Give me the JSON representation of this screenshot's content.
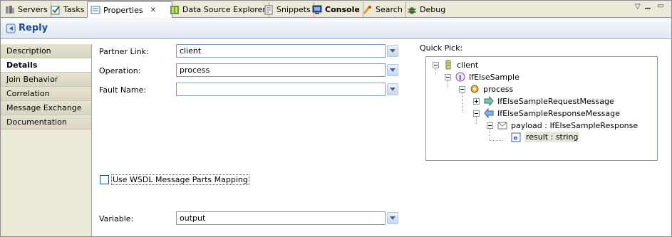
{
  "tabs": [
    {
      "label": "Servers",
      "icon": "servers-icon"
    },
    {
      "label": "Tasks",
      "icon": "tasks-icon"
    },
    {
      "label": "Properties",
      "icon": "properties-icon",
      "active": true
    },
    {
      "label": "Data Source Explorer",
      "icon": "data-source-icon"
    },
    {
      "label": "Snippets",
      "icon": "snippets-icon"
    },
    {
      "label": "Console",
      "icon": "console-icon"
    },
    {
      "label": "Search",
      "icon": "search-icon"
    },
    {
      "label": "Debug",
      "icon": "debug-icon"
    }
  ],
  "header": {
    "title": "Reply",
    "icon": "reply-icon"
  },
  "nav": [
    "Description",
    "Details",
    "Join Behavior",
    "Correlation",
    "Message Exchange",
    "Documentation"
  ],
  "nav_active": "Details",
  "form": {
    "partner_link_label": "Partner Link:",
    "partner_link_value": "client",
    "operation_label": "Operation:",
    "operation_value": "process",
    "fault_name_label": "Fault Name:",
    "fault_name_value": "",
    "wsdl_mapping_label": "Use WSDL Message Parts Mapping",
    "wsdl_mapping_checked": false,
    "variable_label": "Variable:",
    "variable_value": "output"
  },
  "quick_pick": {
    "label": "Quick Pick:",
    "tree": [
      {
        "text": "client",
        "icon": "partner-link-icon"
      },
      {
        "text": "IfElseSample",
        "icon": "interface-icon"
      },
      {
        "text": "process",
        "icon": "operation-icon"
      },
      {
        "text": "IfElseSampleRequestMessage",
        "icon": "input-message-icon"
      },
      {
        "text": "IfElseSampleResponseMessage",
        "icon": "output-message-icon"
      },
      {
        "text": "payload : IfElseSampleResponse",
        "icon": "part-icon"
      },
      {
        "text": "result : string",
        "icon": "element-icon"
      }
    ]
  },
  "colors": {
    "header_title": "#1e4e8c",
    "input_border": "#7f9db9",
    "panel": "#ece9d8"
  }
}
